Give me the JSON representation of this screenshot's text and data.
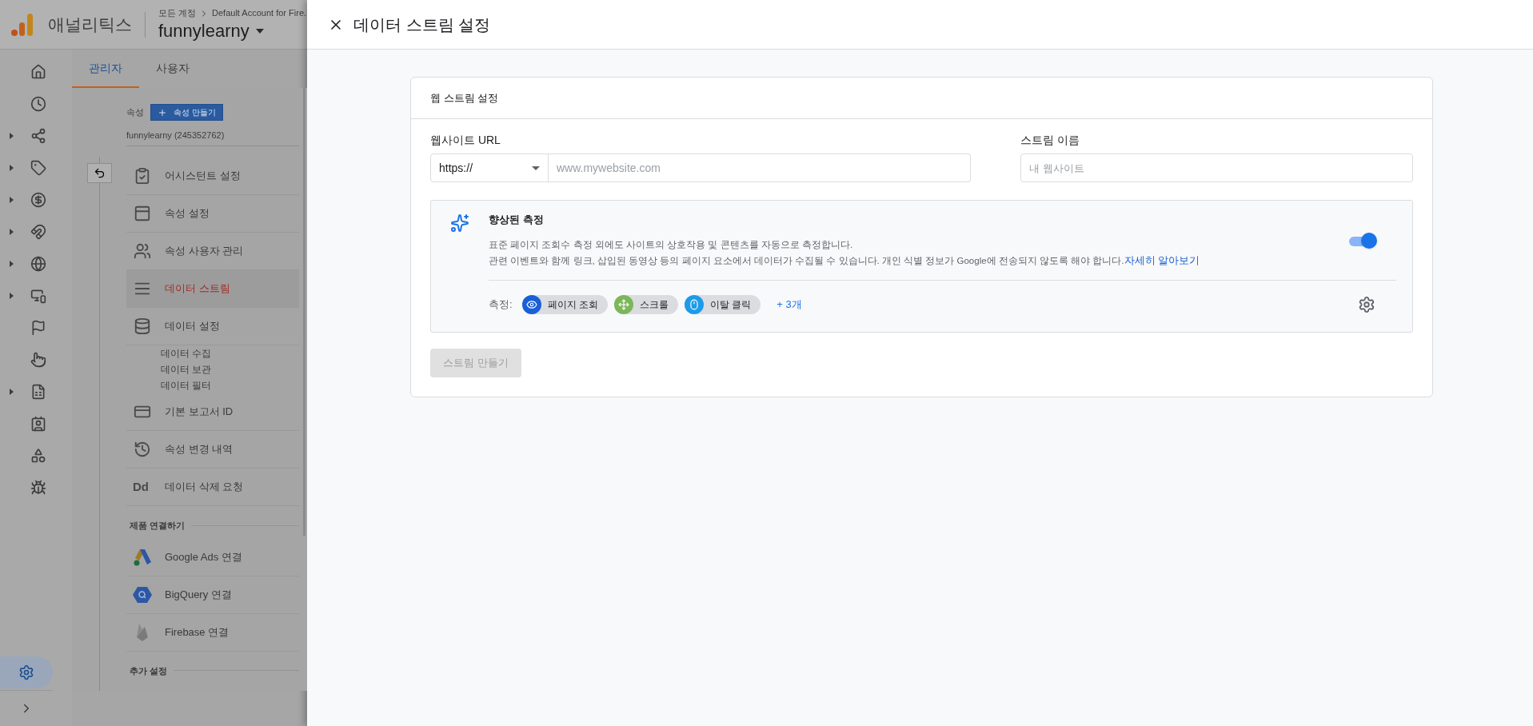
{
  "app": {
    "product_name": "애널리틱스",
    "breadcrumb": [
      "모든 계정",
      "Default Account for Fire."
    ],
    "property_selector": "funnylearny"
  },
  "rail": [
    {
      "kind": "home",
      "expandable": false,
      "selected": false
    },
    {
      "kind": "reports",
      "expandable": false,
      "selected": false
    },
    {
      "kind": "explore",
      "expandable": true,
      "selected": false
    },
    {
      "kind": "tag",
      "expandable": true,
      "selected": false
    },
    {
      "kind": "money",
      "expandable": true,
      "selected": false
    },
    {
      "kind": "magnet",
      "expandable": true,
      "selected": false
    },
    {
      "kind": "globe",
      "expandable": true,
      "selected": false
    },
    {
      "kind": "devices",
      "expandable": true,
      "selected": false
    },
    {
      "kind": "flag",
      "expandable": false,
      "selected": false
    },
    {
      "kind": "pointer",
      "expandable": false,
      "selected": false
    },
    {
      "kind": "chart",
      "expandable": true,
      "selected": false
    },
    {
      "kind": "audience",
      "expandable": false,
      "selected": false
    },
    {
      "kind": "shapes",
      "expandable": false,
      "selected": false
    },
    {
      "kind": "bug",
      "expandable": false,
      "selected": false
    }
  ],
  "rail_settings": {
    "selected": true
  },
  "admin_tabs": [
    {
      "label": "관리자",
      "selected": true
    },
    {
      "label": "사용자",
      "selected": false
    }
  ],
  "property": {
    "label": "속성",
    "create_button": "속성 만들기",
    "account": "funnylearny (245352762)"
  },
  "menu": [
    {
      "kind": "assistant",
      "label": "어시스턴트 설정",
      "selected": false
    },
    {
      "kind": "property",
      "label": "속성 설정",
      "selected": false
    },
    {
      "kind": "users",
      "label": "속성 사용자 관리",
      "selected": false
    },
    {
      "kind": "streams",
      "label": "데이터 스트림",
      "selected": true
    },
    {
      "kind": "data",
      "label": "데이터 설정",
      "selected": false
    },
    {
      "kind": "sub",
      "label": "데이터 수집",
      "selected": false
    },
    {
      "kind": "sub",
      "label": "데이터 보관",
      "selected": false
    },
    {
      "kind": "sub",
      "label": "데이터 필터",
      "selected": false
    },
    {
      "kind": "report-id",
      "label": "기본 보고서 ID",
      "selected": false
    },
    {
      "kind": "history",
      "label": "속성 변경 내역",
      "selected": false
    },
    {
      "kind": "delete",
      "badge": "Dd",
      "label": "데이터 삭제 요청",
      "selected": false
    },
    {
      "kind": "section",
      "label": "제품 연결하기"
    },
    {
      "kind": "ads",
      "label": "Google Ads 연결",
      "selected": false
    },
    {
      "kind": "bigquery",
      "label": "BigQuery 연결",
      "selected": false
    },
    {
      "kind": "firebase",
      "label": "Firebase 연결",
      "selected": false
    },
    {
      "kind": "section",
      "label": "추가 설정"
    }
  ],
  "dialog": {
    "title": "데이터 스트림 설정",
    "card_title": "웹 스트림 설정",
    "url_label": "웹사이트 URL",
    "protocol": "https://",
    "url_placeholder": "www.mywebsite.com",
    "name_label": "스트림 이름",
    "name_placeholder": "내 웹사이트",
    "enhanced": {
      "title": "향상된 측정",
      "description": [
        "표준 페이지 조회수 측정 외에도 사이트의 상호작용 및 콘텐츠를 자동으로 측정합니다.",
        "관련 이벤트와 함께 링크, 삽입된 동영상 등의 페이지 요소에서 데이터가 수집될 수 있습니다. 개인 식별 정보가 Google에 전송되지 않도록 해야 합니다."
      ],
      "link": "자세히 알아보기",
      "on": true,
      "measure_label": "측정:",
      "chips": [
        {
          "kind": "page-view",
          "label": "페이지 조회"
        },
        {
          "kind": "scroll",
          "label": "스크롤"
        },
        {
          "kind": "outbound",
          "label": "이탈 클릭"
        }
      ],
      "more": "+ 3개"
    },
    "create_button": {
      "label": "스트림 만들기",
      "disabled": true
    }
  }
}
